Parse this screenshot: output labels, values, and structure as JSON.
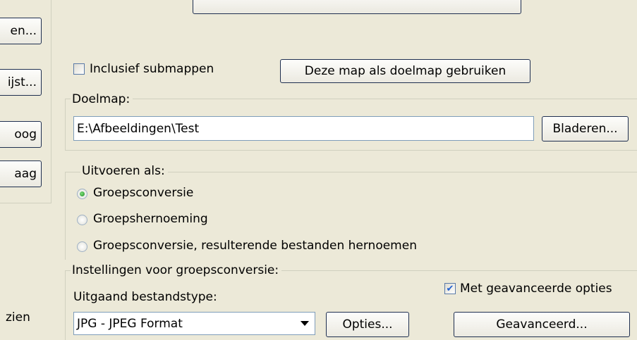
{
  "left_buttons": [
    "en...",
    "ijst...",
    "oog",
    "aag"
  ],
  "left_text": "zien",
  "top_button_label": "",
  "include_subfolders": {
    "label": "Inclusief submappen",
    "checked": false
  },
  "use_as_target_button": "Deze map als doelmap gebruiken",
  "target_folder": {
    "group_label": "Doelmap:",
    "value": "E:\\Afbeeldingen\\Test",
    "browse_button": "Bladeren..."
  },
  "run_as": {
    "group_label": "Uitvoeren als:",
    "options": [
      {
        "label": "Groepsconversie",
        "selected": true
      },
      {
        "label": "Groepshernoeming",
        "selected": false
      },
      {
        "label": "Groepsconversie, resulterende bestanden hernoemen",
        "selected": false
      }
    ]
  },
  "conversion_settings": {
    "group_label": "Instellingen voor groepsconversie:",
    "output_type_label": "Uitgaand bestandstype:",
    "output_type_value": "JPG - JPEG Format",
    "options_button": "Opties...",
    "advanced_checkbox": {
      "label": "Met geavanceerde opties",
      "checked": true
    },
    "advanced_button": "Geavanceerd..."
  }
}
